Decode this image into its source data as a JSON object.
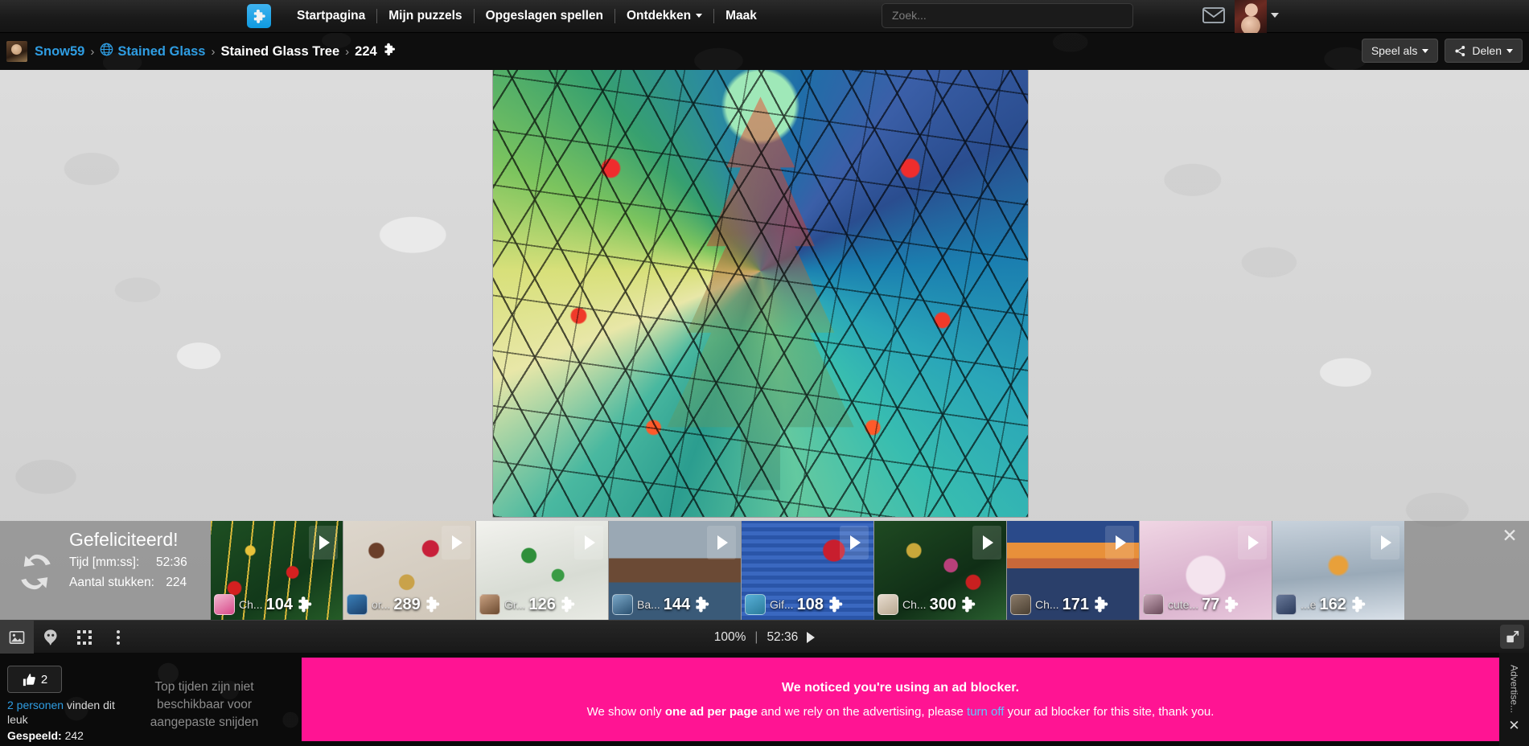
{
  "topnav": {
    "logo_icon": "puzzle-piece-icon",
    "links": [
      {
        "label": "Startpagina",
        "has_caret": false
      },
      {
        "label": "Mijn puzzels",
        "has_caret": false
      },
      {
        "label": "Opgeslagen spellen",
        "has_caret": false
      },
      {
        "label": "Ontdekken",
        "has_caret": true
      },
      {
        "label": "Maak",
        "has_caret": false
      }
    ],
    "search_placeholder": "Zoek...",
    "search_value": "",
    "mail_icon": "envelope-icon",
    "avatar_icon": "user-avatar",
    "avatar_caret_icon": "chevron-down-icon"
  },
  "breadcrumb": {
    "avatar_icon": "user-avatar",
    "items": [
      {
        "label": "Snow59",
        "type": "link"
      },
      {
        "label": "Stained Glass",
        "type": "link",
        "icon": "globe-icon"
      },
      {
        "label": "Stained Glass Tree",
        "type": "text"
      },
      {
        "label": "224",
        "type": "text",
        "icon": "puzzle-piece-icon"
      }
    ],
    "separator": "›",
    "play_as_label": "Speel als",
    "share_label": "Delen",
    "share_icon": "share-icon"
  },
  "board": {
    "puzzle_title": "Stained Glass Tree",
    "background": "#d6d6d6"
  },
  "filmstrip": {
    "congrats_title": "Gefeliciteerd!",
    "time_label": "Tijd [mm:ss]:",
    "time_value": "52:36",
    "pieces_label": "Aantal stukken:",
    "pieces_value": "224",
    "replay_icon": "replay-icon",
    "close_icon": "close-icon",
    "play_icon": "play-icon",
    "piece_icon": "puzzle-piece-icon",
    "thumbnails": [
      {
        "name": "Ch...",
        "count": "104",
        "theme": "christmas-tree-garland"
      },
      {
        "name": "or...",
        "count": "289",
        "theme": "christmas-sweets-flatlay"
      },
      {
        "name": "Gr...",
        "count": "126",
        "theme": "white-green-christmas-decor"
      },
      {
        "name": "Ba...",
        "count": "144",
        "theme": "vintage-truck"
      },
      {
        "name": "Gif...",
        "count": "108",
        "theme": "gift-boxes"
      },
      {
        "name": "Ch...",
        "count": "300",
        "theme": "ornaments-on-tree"
      },
      {
        "name": "Ch...",
        "count": "171",
        "theme": "pier-sunset"
      },
      {
        "name": "cute...",
        "count": "77",
        "theme": "cute-deer-pink"
      },
      {
        "name": "...e",
        "count": "162",
        "theme": "snow-village"
      }
    ]
  },
  "controlbar": {
    "icons": [
      {
        "name": "image-icon",
        "active": true
      },
      {
        "name": "puzzle-ghost-icon",
        "active": false
      },
      {
        "name": "grid-icon",
        "active": false
      },
      {
        "name": "more-options-icon",
        "active": false
      }
    ],
    "zoom_level": "100%",
    "separator": "|",
    "timer": "52:36",
    "play_icon": "play-icon",
    "fullscreen_icon": "fullscreen-icon"
  },
  "footer": {
    "like_icon": "thumbs-up-icon",
    "like_count": "2",
    "like_text_link": "2 personen",
    "like_text_rest": " vinden dit leuk",
    "played_label": "Gespeeld:",
    "played_value": "242",
    "top_times_message": "Top tijden zijn niet beschikbaar voor aangepaste snijden"
  },
  "adblock": {
    "line1": "We noticed you're using an ad blocker.",
    "line2_part1": "We show only ",
    "line2_bold": "one ad per page",
    "line2_part2": " and we rely on the advertising, please ",
    "line2_link": "turn off",
    "line2_part3": " your ad blocker for this site, thank you.",
    "background_color": "#ff1493"
  },
  "adrail": {
    "vertical_label": "Advertise...",
    "close_icon": "close-icon"
  }
}
